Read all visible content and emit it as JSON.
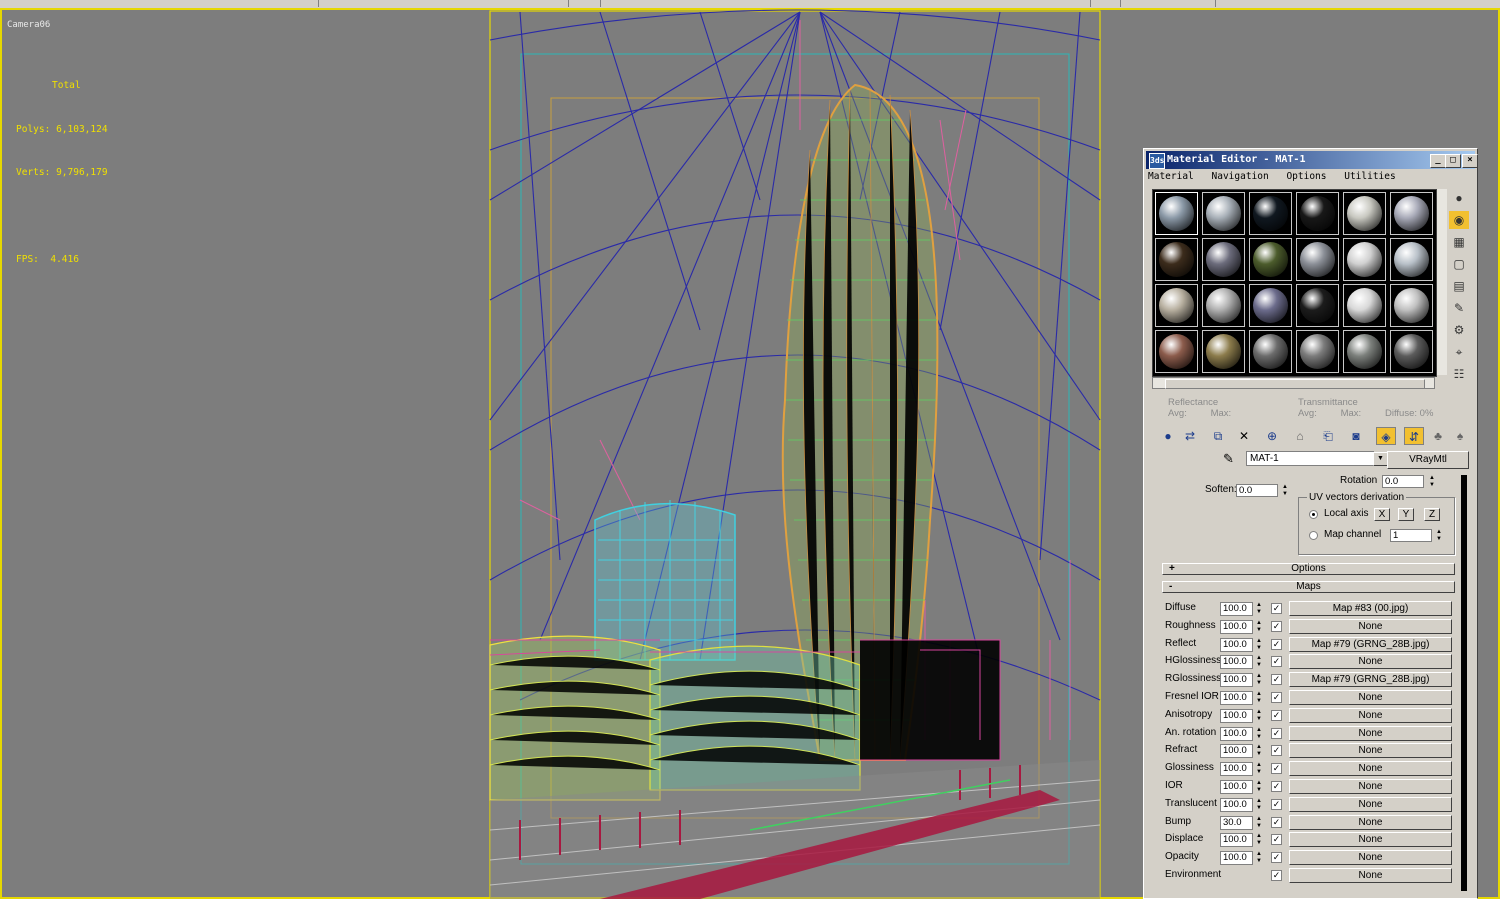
{
  "viewport": {
    "label": "Camera06",
    "stats_header": "Total",
    "polys_label": "Polys:",
    "polys_value": "6,103,124",
    "verts_label": "Verts:",
    "verts_value": "9,796,179",
    "fps_label": "FPS:",
    "fps_value": "4.416"
  },
  "material_editor": {
    "title": "Material Editor - MAT-1",
    "menu": [
      "Material",
      "Navigation",
      "Options",
      "Utilities"
    ],
    "window_buttons": {
      "minimize": "_",
      "maximize": "□",
      "close": "×"
    },
    "reflectance": {
      "title": "Reflectance",
      "avg": "Avg:",
      "max": "Max:"
    },
    "transmittance": {
      "title": "Transmittance",
      "avg": "Avg:",
      "max": "Max:",
      "diffuse": "Diffuse:",
      "diffuse_value": "0%"
    },
    "material_name": "MAT-1",
    "material_type": "VRayMtl",
    "rotation_label": "Rotation",
    "rotation_value": "0.0",
    "soften_label": "Soften:",
    "soften_value": "0.0",
    "uv_group_title": "UV vectors derivation",
    "local_axis_label": "Local axis",
    "axes": [
      "X",
      "Y",
      "Z"
    ],
    "map_channel_label": "Map channel",
    "map_channel_value": "1",
    "options_rollout": "Options",
    "options_sign": "+",
    "maps_rollout": "Maps",
    "maps_sign": "-",
    "check": "✓",
    "maps": [
      {
        "label": "Diffuse",
        "amount": "100.0",
        "map": "Map #83 (00.jpg)"
      },
      {
        "label": "Roughness",
        "amount": "100.0",
        "map": "None"
      },
      {
        "label": "Reflect",
        "amount": "100.0",
        "map": "Map #79 (GRNG_28B.jpg)"
      },
      {
        "label": "HGlossiness",
        "amount": "100.0",
        "map": "None"
      },
      {
        "label": "RGlossiness",
        "amount": "100.0",
        "map": "Map #79 (GRNG_28B.jpg)"
      },
      {
        "label": "Fresnel IOR",
        "amount": "100.0",
        "map": "None"
      },
      {
        "label": "Anisotropy",
        "amount": "100.0",
        "map": "None"
      },
      {
        "label": "An. rotation",
        "amount": "100.0",
        "map": "None"
      },
      {
        "label": "Refract",
        "amount": "100.0",
        "map": "None"
      },
      {
        "label": "Glossiness",
        "amount": "100.0",
        "map": "None"
      },
      {
        "label": "IOR",
        "amount": "100.0",
        "map": "None"
      },
      {
        "label": "Translucent",
        "amount": "100.0",
        "map": "None"
      },
      {
        "label": "Bump",
        "amount": "30.0",
        "map": "None"
      },
      {
        "label": "Displace",
        "amount": "100.0",
        "map": "None"
      },
      {
        "label": "Opacity",
        "amount": "100.0",
        "map": "None"
      },
      {
        "label": "Environment",
        "amount": "",
        "map": "None"
      }
    ],
    "slot_colors": [
      "#8c9aa8",
      "#a8b0b8",
      "#101820",
      "#181818",
      "#c8c8c0",
      "#a8aab8",
      "#3c2c1c",
      "#6c6c7c",
      "#4c5c2c",
      "#8c9098",
      "#d0d0d0",
      "#b8c0c8",
      "#b8b0a0",
      "#b0b0b0",
      "#6c6c8c",
      "#1c1c1c",
      "#d8d8d8",
      "#c0c0c0",
      "#8c5c4c",
      "#8c7c4c",
      "#6c6c6c",
      "#7c7c7c",
      "#7c807c",
      "#5c5c5c"
    ]
  }
}
